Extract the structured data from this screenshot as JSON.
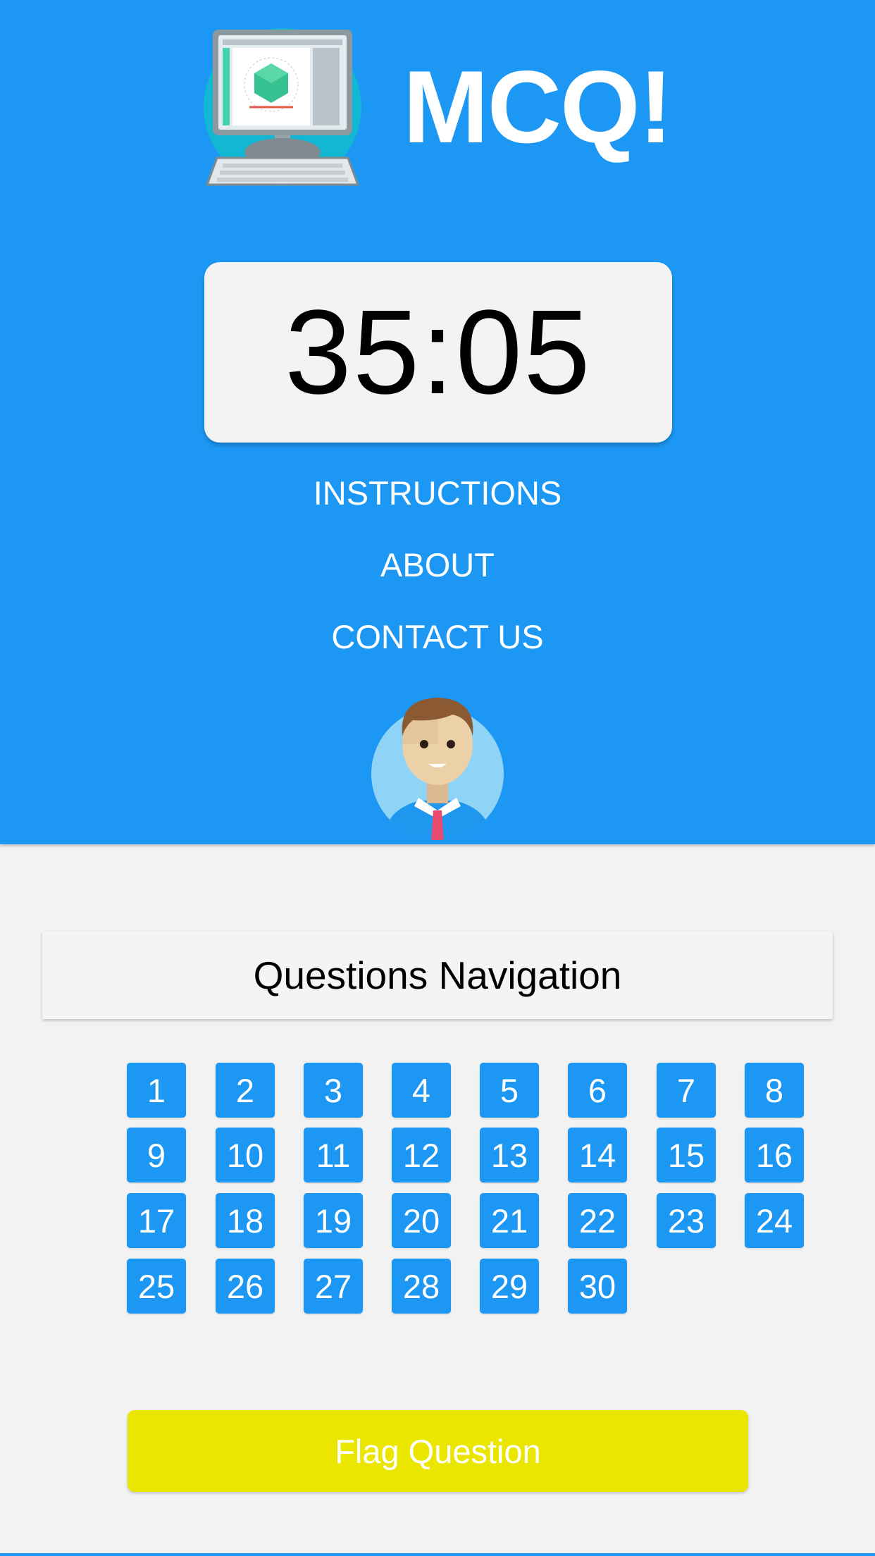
{
  "header": {
    "app_title": "MCQ!",
    "logo_icon": "computer-monitor-icon",
    "timer": "35:05",
    "nav": [
      "INSTRUCTIONS",
      "ABOUT",
      "CONTACT US"
    ],
    "avatar_icon": "user-avatar-icon"
  },
  "questions_nav": {
    "title": "Questions Navigation",
    "questions": [
      "1",
      "2",
      "3",
      "4",
      "5",
      "6",
      "7",
      "8",
      "9",
      "10",
      "11",
      "12",
      "13",
      "14",
      "15",
      "16",
      "17",
      "18",
      "19",
      "20",
      "21",
      "22",
      "23",
      "24",
      "25",
      "26",
      "27",
      "28",
      "29",
      "30"
    ]
  },
  "flag_button": {
    "label": "Flag Question"
  },
  "colors": {
    "primary": "#1c97f3",
    "flag": "#ebe600",
    "background": "#f2f2f2"
  }
}
